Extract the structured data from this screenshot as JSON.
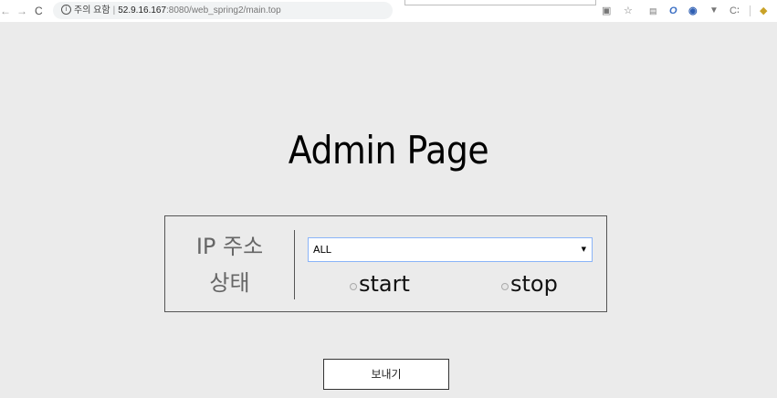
{
  "browser": {
    "back_glyph": "←",
    "forward_glyph": "→",
    "reload_glyph": "C",
    "security_text": "주의 요함",
    "url_host": "52.9.16.167",
    "url_rest": ":8080/web_spring2/main.top",
    "extensions": [
      "translate-icon",
      "star-icon",
      "screen-icon",
      "extension-icon-1",
      "extension-icon-2",
      "vpn-icon",
      "cuckoo-icon",
      "puzzle-icon"
    ]
  },
  "page": {
    "title": "Admin Page"
  },
  "form": {
    "ip_label": "IP 주소",
    "status_label": "상태",
    "ip_select": {
      "selected": "ALL"
    },
    "status_options": [
      {
        "label": "start"
      },
      {
        "label": "stop"
      }
    ],
    "submit_label": "보내기"
  },
  "colors": {
    "page_bg": "#ebebeb",
    "select_border": "#8ab4f8",
    "label_gray": "#666666"
  }
}
